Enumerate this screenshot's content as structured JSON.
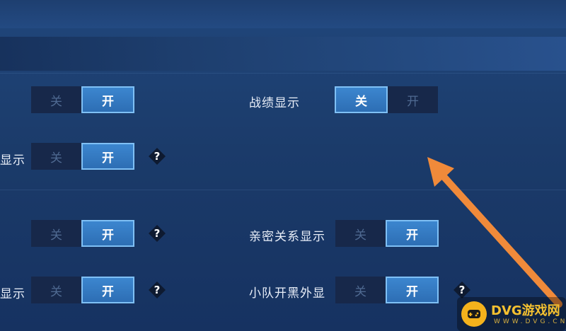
{
  "toggle_labels": {
    "off": "关",
    "on": "开"
  },
  "help_glyph": "?",
  "rows": [
    {
      "label": "",
      "state": "on",
      "help": false
    },
    {
      "label": "显示",
      "state": "on",
      "help": true
    },
    {
      "label": "",
      "state": "on",
      "help": true
    },
    {
      "label": "显示",
      "state": "on",
      "help": true
    }
  ],
  "right_rows": [
    {
      "label": "战绩显示",
      "state": "off",
      "help": false
    },
    {
      "label": "亲密关系显示",
      "state": "on",
      "help": false
    },
    {
      "label": "小队开黑外显",
      "state": "on",
      "help": true
    }
  ],
  "watermark": {
    "name": "DVG游戏网",
    "url": "WWW.DVG.CN"
  },
  "colors": {
    "accent": "#2d6eb4",
    "arrow": "#f08a3a",
    "logo": "#f4b21c"
  }
}
